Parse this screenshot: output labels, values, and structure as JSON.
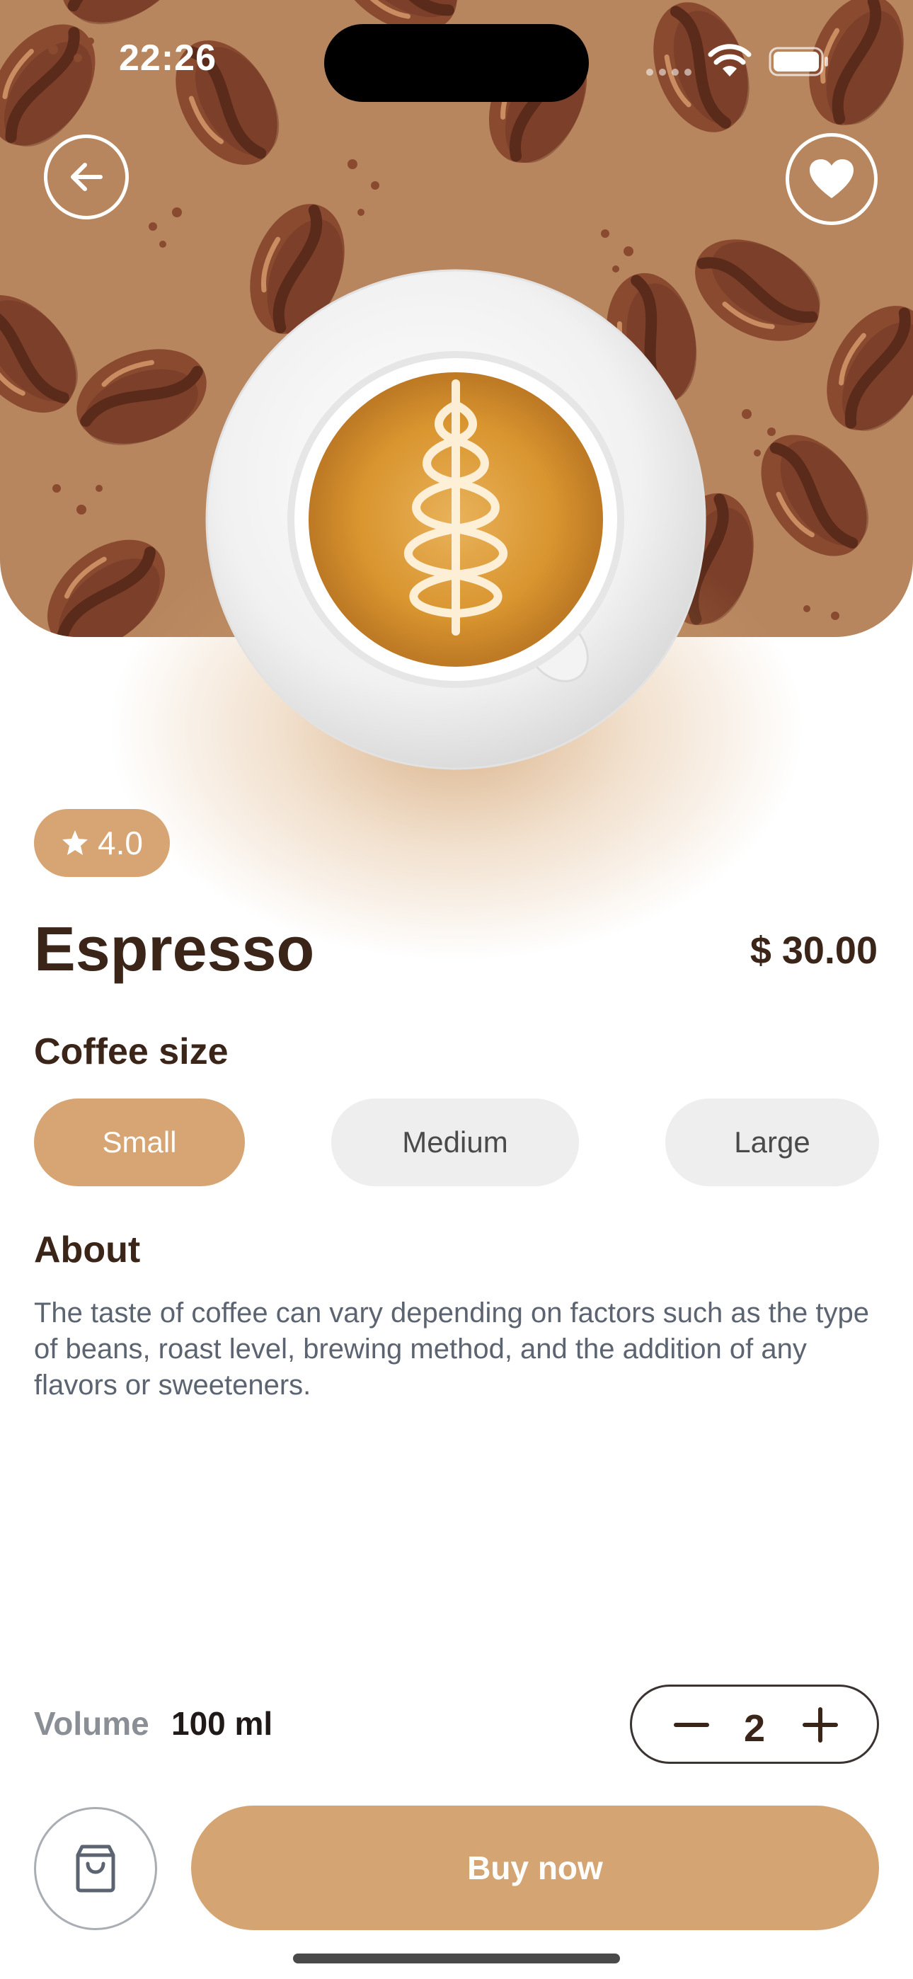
{
  "status_bar": {
    "time": "22:26"
  },
  "product": {
    "rating": "4.0",
    "name": "Espresso",
    "price": "$ 30.00"
  },
  "sizes": {
    "title": "Coffee size",
    "options": [
      "Small",
      "Medium",
      "Large"
    ],
    "selected": "Small"
  },
  "about": {
    "title": "About",
    "text": "The taste of coffee can vary depending on factors such as the type of beans, roast level, brewing method, and the addition of any flavors or sweeteners."
  },
  "volume": {
    "label": "Volume",
    "value": "100 ml"
  },
  "quantity": {
    "value": "2"
  },
  "actions": {
    "buy_label": "Buy now"
  },
  "icons": {
    "back": "arrow-left-icon",
    "favorite": "heart-icon",
    "rating": "star-icon",
    "cart": "shopping-bag-icon",
    "decrease": "minus-icon",
    "increase": "plus-icon"
  },
  "colors": {
    "accent": "#d7a573",
    "hero_background": "#b7865f",
    "bean": "#8a4a30",
    "text_dark": "#3b2418",
    "chip_inactive": "#eeeeee"
  }
}
